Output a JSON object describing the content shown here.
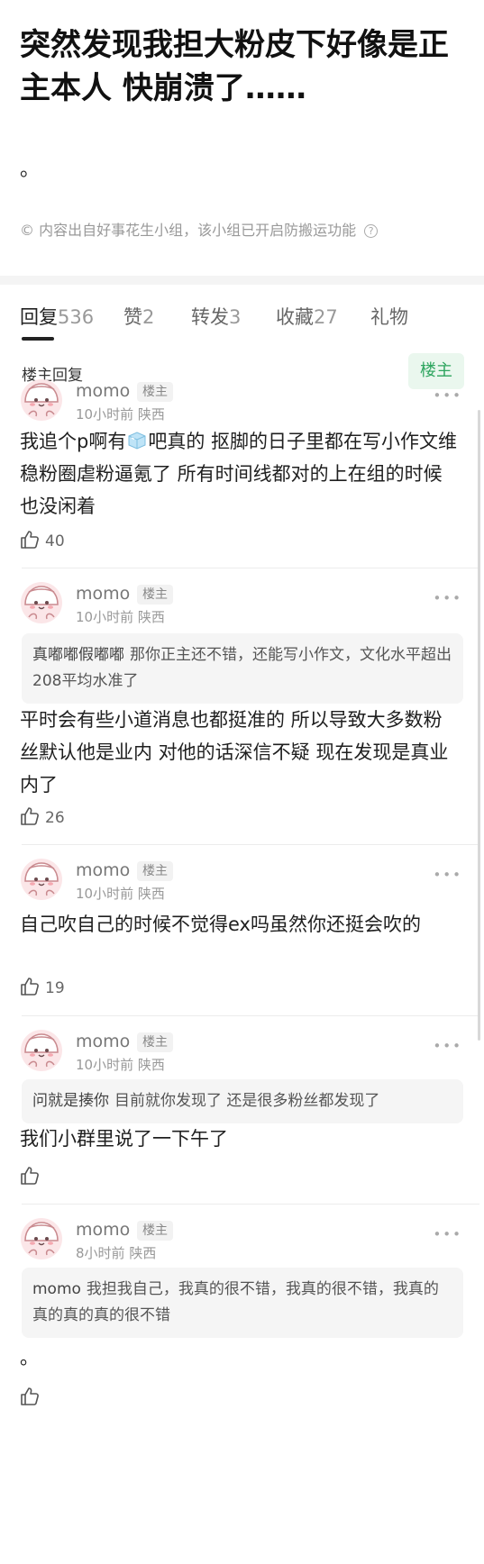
{
  "post": {
    "title": "突然发现我担大粉皮下好像是正主本人 快崩溃了……",
    "body": "。",
    "source": "内容出自好事花生小组，该小组已开启防搬运功能"
  },
  "tabs": [
    {
      "label": "回复",
      "count": "536"
    },
    {
      "label": "赞",
      "count": "2"
    },
    {
      "label": "转发",
      "count": "3"
    },
    {
      "label": "收藏",
      "count": "27"
    },
    {
      "label": "礼物",
      "count": ""
    }
  ],
  "filter": {
    "label": "楼主回复",
    "button": "楼主"
  },
  "comments": [
    {
      "name": "momo",
      "badge": "楼主",
      "time": "10小时前",
      "location": "陕西",
      "quote_name": "",
      "quote_text": "",
      "text_a": "我追个p啊有",
      "text_b": "吧真的 抠脚的日子里都在写小作文维稳粉圈虐粉逼氪了 所有时间线都对的上在组的时候也没闲着",
      "likes": "40"
    },
    {
      "name": "momo",
      "badge": "楼主",
      "time": "10小时前",
      "location": "陕西",
      "quote_name": "真嘟嘟假嘟嘟",
      "quote_text": "那你正主还不错，还能写小作文，文化水平超出208平均水准了",
      "text": "平时会有些小道消息也都挺准的 所以导致大多数粉丝默认他是业内 对他的话深信不疑 现在发现是真业内了",
      "likes": "26"
    },
    {
      "name": "momo",
      "badge": "楼主",
      "time": "10小时前",
      "location": "陕西",
      "quote_name": "",
      "quote_text": "",
      "text": "自己吹自己的时候不觉得ex吗虽然你还挺会吹的",
      "likes": "19"
    },
    {
      "name": "momo",
      "badge": "楼主",
      "time": "10小时前",
      "location": "陕西",
      "quote_name": "问就是揍你",
      "quote_text": "目前就你发现了 还是很多粉丝都发现了",
      "text": "我们小群里说了一下午了",
      "likes": ""
    },
    {
      "name": "momo",
      "badge": "楼主",
      "time": "8小时前",
      "location": "陕西",
      "quote_name": "momo",
      "quote_text": "我担我自己，我真的很不错，我真的很不错，我真的真的真的真的很不错",
      "text": "。",
      "likes": ""
    }
  ],
  "icons": {
    "avatar": "cartoon-avatar-icon",
    "like": "thumb-up-icon",
    "more": "more-dots-icon",
    "ice": "ice-cube-emoji-icon",
    "help": "question-circle-icon"
  },
  "colors": {
    "accent_green": "#2ea55f",
    "badge_bg": "#eaf7ee"
  }
}
